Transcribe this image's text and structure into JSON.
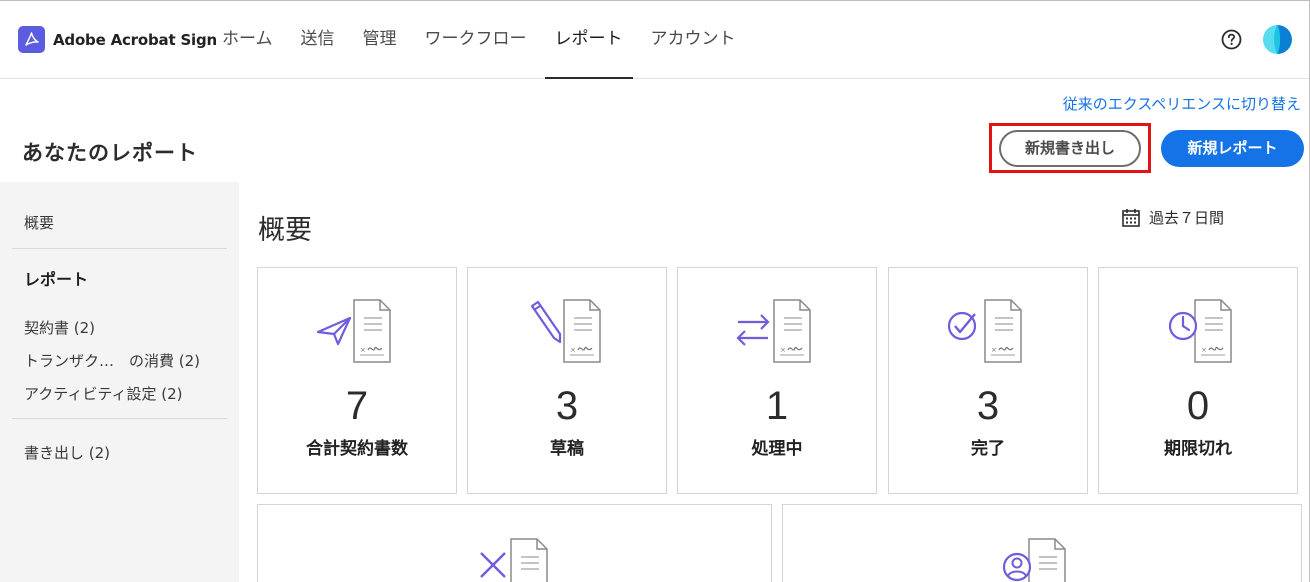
{
  "header": {
    "app_title": "Adobe Acrobat Sign",
    "nav": [
      {
        "label": "ホーム"
      },
      {
        "label": "送信"
      },
      {
        "label": "管理"
      },
      {
        "label": "ワークフロー"
      },
      {
        "label": "レポート",
        "active": true
      },
      {
        "label": "アカウント"
      }
    ],
    "icons": {
      "help": "help-circle-icon",
      "avatar": "user-avatar"
    }
  },
  "switch_link": "従来のエクスペリエンスに切り替え",
  "page_title": "あなたのレポート",
  "buttons": {
    "new_export": "新規書き出し",
    "new_report": "新規レポート"
  },
  "sidebar": {
    "overview": "概要",
    "reports_heading": "レポート",
    "report_items": [
      "契約書 (2)",
      "トランザク…　の消費 (2)",
      "アクティビティ設定 (2)"
    ],
    "exports": "書き出し (2)"
  },
  "main": {
    "title": "概要",
    "date_range": "過去７日間",
    "cards": [
      {
        "count": "7",
        "label": "合計契約書数",
        "icon": "send-document-icon"
      },
      {
        "count": "3",
        "label": "草稿",
        "icon": "draft-pen-document-icon"
      },
      {
        "count": "1",
        "label": "処理中",
        "icon": "in-progress-arrows-document-icon"
      },
      {
        "count": "3",
        "label": "完了",
        "icon": "completed-check-document-icon"
      },
      {
        "count": "0",
        "label": "期限切れ",
        "icon": "expired-clock-document-icon"
      }
    ],
    "bottom_cards": [
      {
        "icon": "cancelled-x-document-icon"
      },
      {
        "icon": "user-document-icon"
      }
    ]
  },
  "colors": {
    "accent": "#1473e6",
    "icon_purple": "#6e5ddc",
    "highlight": "#e01414",
    "logo": "#5c5ce0"
  }
}
